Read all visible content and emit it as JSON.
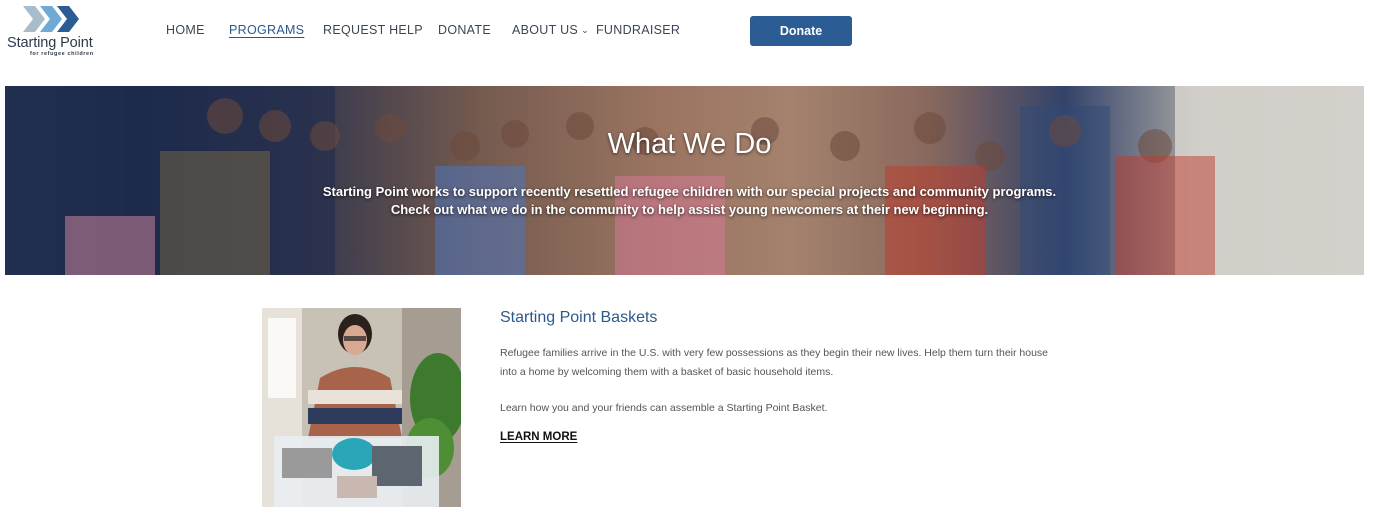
{
  "brand": {
    "name": "Starting Point",
    "tagline": "for refugee children",
    "colors": {
      "primary": "#2b5c93",
      "chevron_light": "#9fb7c9",
      "chevron_mid": "#5aa0d0",
      "chevron_dark": "#2b5c93"
    }
  },
  "nav": {
    "items": [
      {
        "label": "HOME"
      },
      {
        "label": "PROGRAMS",
        "active": true
      },
      {
        "label": "REQUEST HELP"
      },
      {
        "label": "DONATE"
      },
      {
        "label": "ABOUT US"
      },
      {
        "label": "FUNDRAISER"
      }
    ],
    "about_chevron": "⌄",
    "donate_button": "Donate"
  },
  "hero": {
    "title": "What We Do",
    "line1": "Starting Point works to support recently resettled refugee children with our special projects and community programs.",
    "line2": "Check out what we do in the community to help assist young newcomers at their new beginning."
  },
  "program": {
    "title": "Starting Point Baskets",
    "para1_line1": "Refugee families arrive in the U.S. with very few possessions as they begin their new lives. Help them turn their house",
    "para1_line2": "into a home by welcoming them with a basket of basic household items.",
    "para2": "Learn how you and your friends can assemble a Starting Point Basket.",
    "learn_more": "LEARN MORE"
  }
}
